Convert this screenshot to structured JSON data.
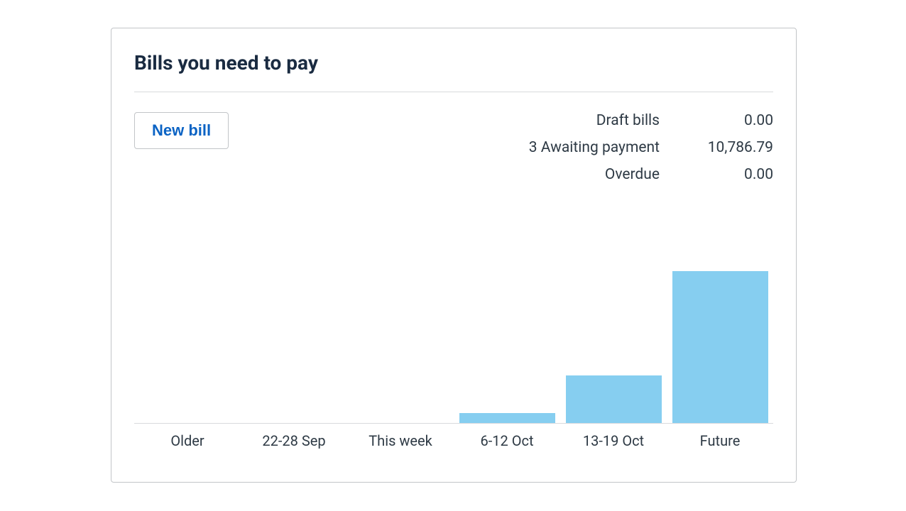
{
  "card": {
    "title": "Bills you need to pay",
    "new_bill_label": "New bill"
  },
  "summary": {
    "draft_label": "Draft bills",
    "draft_value": "0.00",
    "awaiting_label": "3 Awaiting payment",
    "awaiting_value": "10,786.79",
    "overdue_label": "Overdue",
    "overdue_value": "0.00"
  },
  "chart_data": {
    "type": "bar",
    "title": "Bills you need to pay",
    "categories": [
      "Older",
      "22-28 Sep",
      "This week",
      "6-12 Oct",
      "13-19 Oct",
      "Future"
    ],
    "values": [
      0,
      0,
      0,
      700,
      3400,
      10800
    ],
    "xlabel": "",
    "ylabel": "",
    "ylim": [
      0,
      11000
    ]
  },
  "colors": {
    "bar": "#86cef0",
    "accent": "#0b63c4"
  }
}
